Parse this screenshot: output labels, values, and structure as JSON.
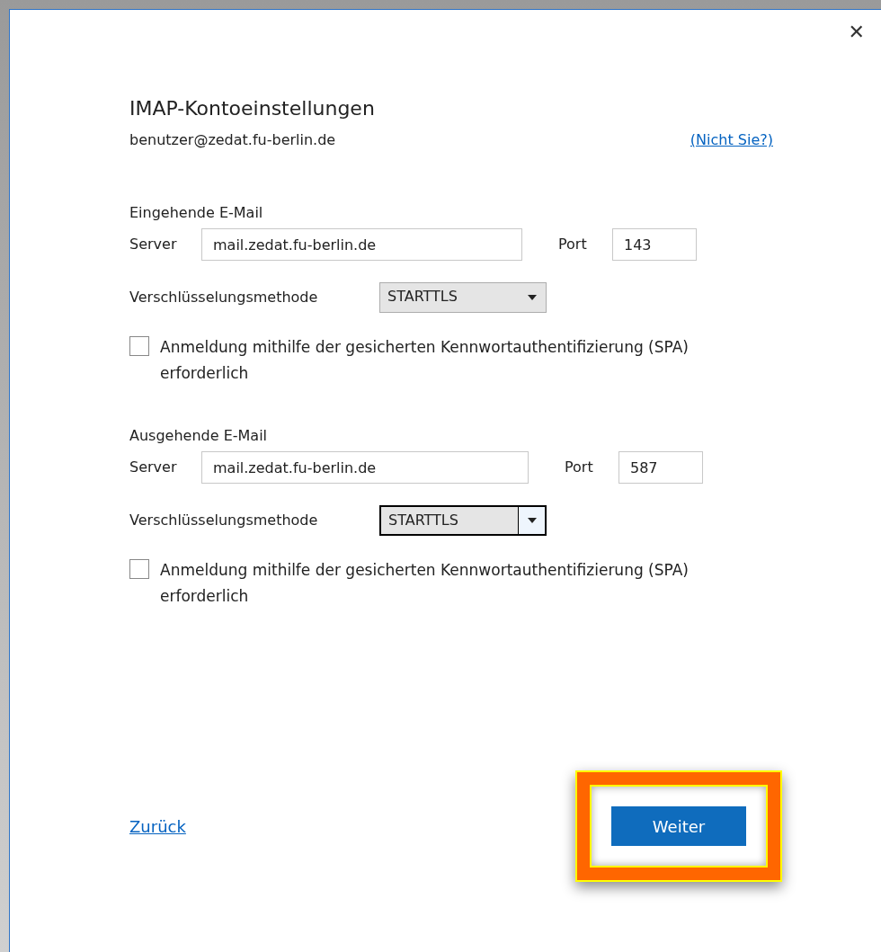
{
  "dialog": {
    "close": "✕",
    "title": "IMAP-Kontoeinstellungen",
    "account": "benutzer@zedat.fu-berlin.de",
    "not_you_link": "(Nicht Sie?)"
  },
  "sections": [
    {
      "heading": "Eingehende E-Mail",
      "server_label": "Server",
      "server": "mail.zedat.fu-berlin.de",
      "port_label": "Port",
      "port": "143",
      "encryption_label": "Verschlüsselungsmethode",
      "encryption": "STARTTLS",
      "encryption_focused": false,
      "spa_label": "Anmeldung mithilfe der gesicherten Kennwortauthentifizierung (SPA) erforderlich",
      "spa_checked": false
    },
    {
      "heading": "Ausgehende E-Mail",
      "server_label": "Server",
      "server": "mail.zedat.fu-berlin.de",
      "port_label": "Port",
      "port": "587",
      "encryption_label": "Verschlüsselungsmethode",
      "encryption": "STARTTLS",
      "encryption_focused": true,
      "spa_label": "Anmeldung mithilfe der gesicherten Kennwortauthentifizierung (SPA) erforderlich",
      "spa_checked": false
    }
  ],
  "footer": {
    "back_link": "Zurück",
    "next_button": "Weiter",
    "next_highlighted": true
  }
}
